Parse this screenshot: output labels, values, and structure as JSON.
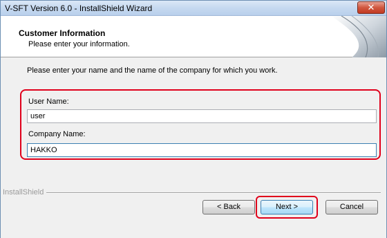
{
  "window": {
    "title": "V-SFT Version 6.0 - InstallShield Wizard",
    "close_glyph": "✕"
  },
  "header": {
    "title": "Customer Information",
    "subtitle": "Please enter your information."
  },
  "body": {
    "instruction": "Please enter your name and the name of the company for which you work.",
    "user_name_label": "User Name:",
    "user_name_value": "user",
    "company_name_label": "Company Name:",
    "company_name_value": "HAKKO"
  },
  "footer": {
    "brand": "InstallShield",
    "back_label": "< Back",
    "next_label": "Next >",
    "cancel_label": "Cancel"
  },
  "colors": {
    "highlight": "#e0001b",
    "title_bar": "#c6d9f0",
    "close_button": "#d0573f"
  },
  "icons": [
    "close-icon",
    "wizard-header-art"
  ]
}
